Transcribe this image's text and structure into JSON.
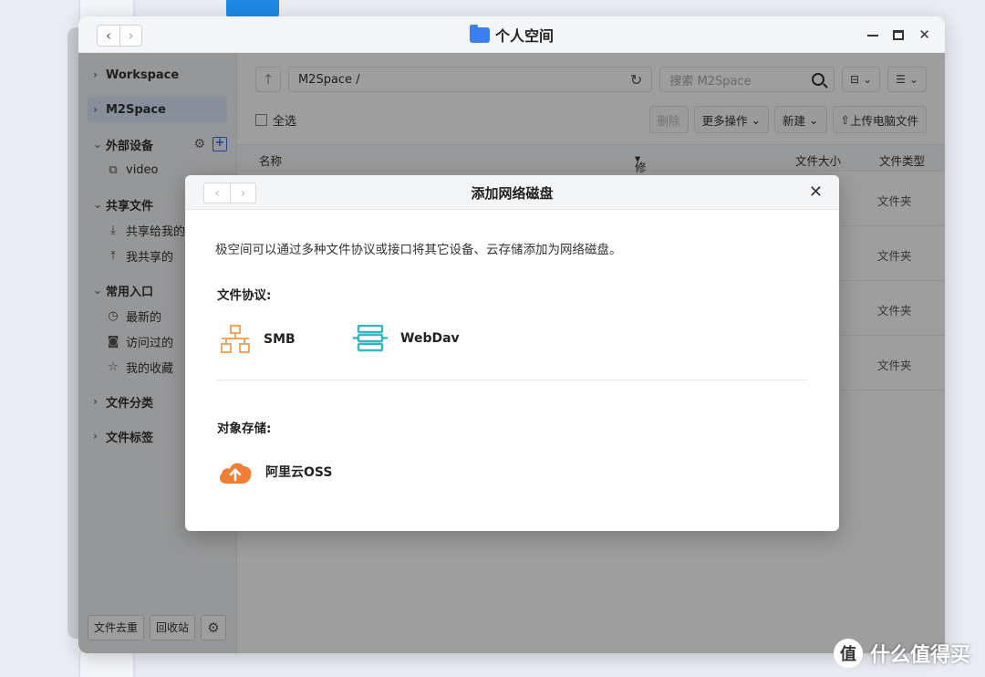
{
  "window": {
    "title": "个人空间",
    "nav_back": "‹",
    "nav_forward": "›",
    "close": "✕"
  },
  "sidebar": {
    "workspace": "Workspace",
    "m2space": "M2Space",
    "external_devices": "外部设备",
    "external_items": [
      "video"
    ],
    "shared_files": "共享文件",
    "shared_items": [
      "共享给我的",
      "我共享的"
    ],
    "common": "常用入口",
    "common_items": [
      "最新的",
      "访问过的",
      "我的收藏"
    ],
    "file_category": "文件分类",
    "file_tags": "文件标签",
    "bottom": {
      "dedupe": "文件去重",
      "recycle": "回收站"
    }
  },
  "toolbar": {
    "path": "M2Space /",
    "search_placeholder": "搜索 M2Space",
    "select_all": "全选",
    "delete": "删除",
    "more": "更多操作",
    "new": "新建",
    "upload": "上传电脑文件"
  },
  "table": {
    "headers": {
      "name": "名称",
      "modified": "修改时间",
      "size": "文件大小",
      "type": "文件类型"
    },
    "rows": [
      {
        "type": "文件夹"
      },
      {
        "type": "文件夹"
      },
      {
        "type": "文件夹"
      },
      {
        "type": "文件夹"
      }
    ]
  },
  "modal": {
    "title": "添加网络磁盘",
    "description": "极空间可以通过多种文件协议或接口将其它设备、云存储添加为网络磁盘。",
    "protocol_section": "文件协议:",
    "protocols": [
      {
        "label": "SMB",
        "icon": "network-icon",
        "color": "#f5a45d"
      },
      {
        "label": "WebDav",
        "icon": "server-stack-icon",
        "color": "#35b5c0"
      }
    ],
    "object_section": "对象存储:",
    "objects": [
      {
        "label": "阿里云OSS",
        "icon": "cloud-upload-icon",
        "color": "#f07f35"
      }
    ]
  },
  "watermark": {
    "icon_text": "值",
    "text": "什么值得买"
  }
}
